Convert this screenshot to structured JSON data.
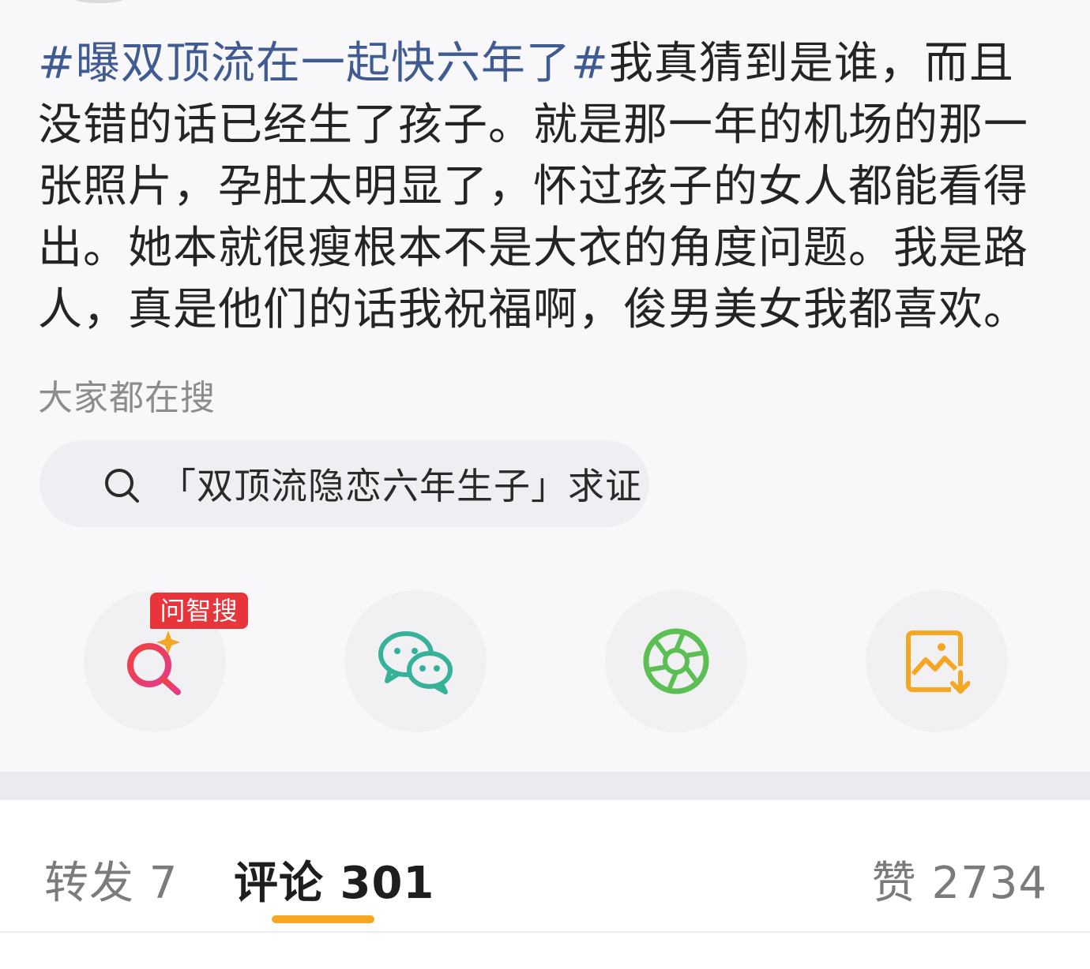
{
  "post": {
    "tag": "#曝双顶流在一起快六年了#",
    "body": "我真猜到是谁，而且没错的话已经生了孩子。就是那一年的机场的那一张照片，孕肚太明显了，怀过孩子的女人都能看得出。她本就很瘦根本不是大衣的角度问题。我是路人，真是他们的话我祝福啊，俊男美女我都喜欢。"
  },
  "search": {
    "header": "大家都在搜",
    "suggestion": "「双顶流隐恋六年生子」求证"
  },
  "actions": {
    "badge": "问智搜",
    "items": [
      {
        "icon": "ai-search-icon"
      },
      {
        "icon": "wechat-icon"
      },
      {
        "icon": "moments-icon"
      },
      {
        "icon": "save-image-icon"
      }
    ]
  },
  "tabs": {
    "repost": "转发 7",
    "comment": "评论 301",
    "like": "赞 2734"
  },
  "colors": {
    "hashtag": "#3f5b92",
    "accent_underline": "#f5a623",
    "badge": "#e8343b"
  }
}
